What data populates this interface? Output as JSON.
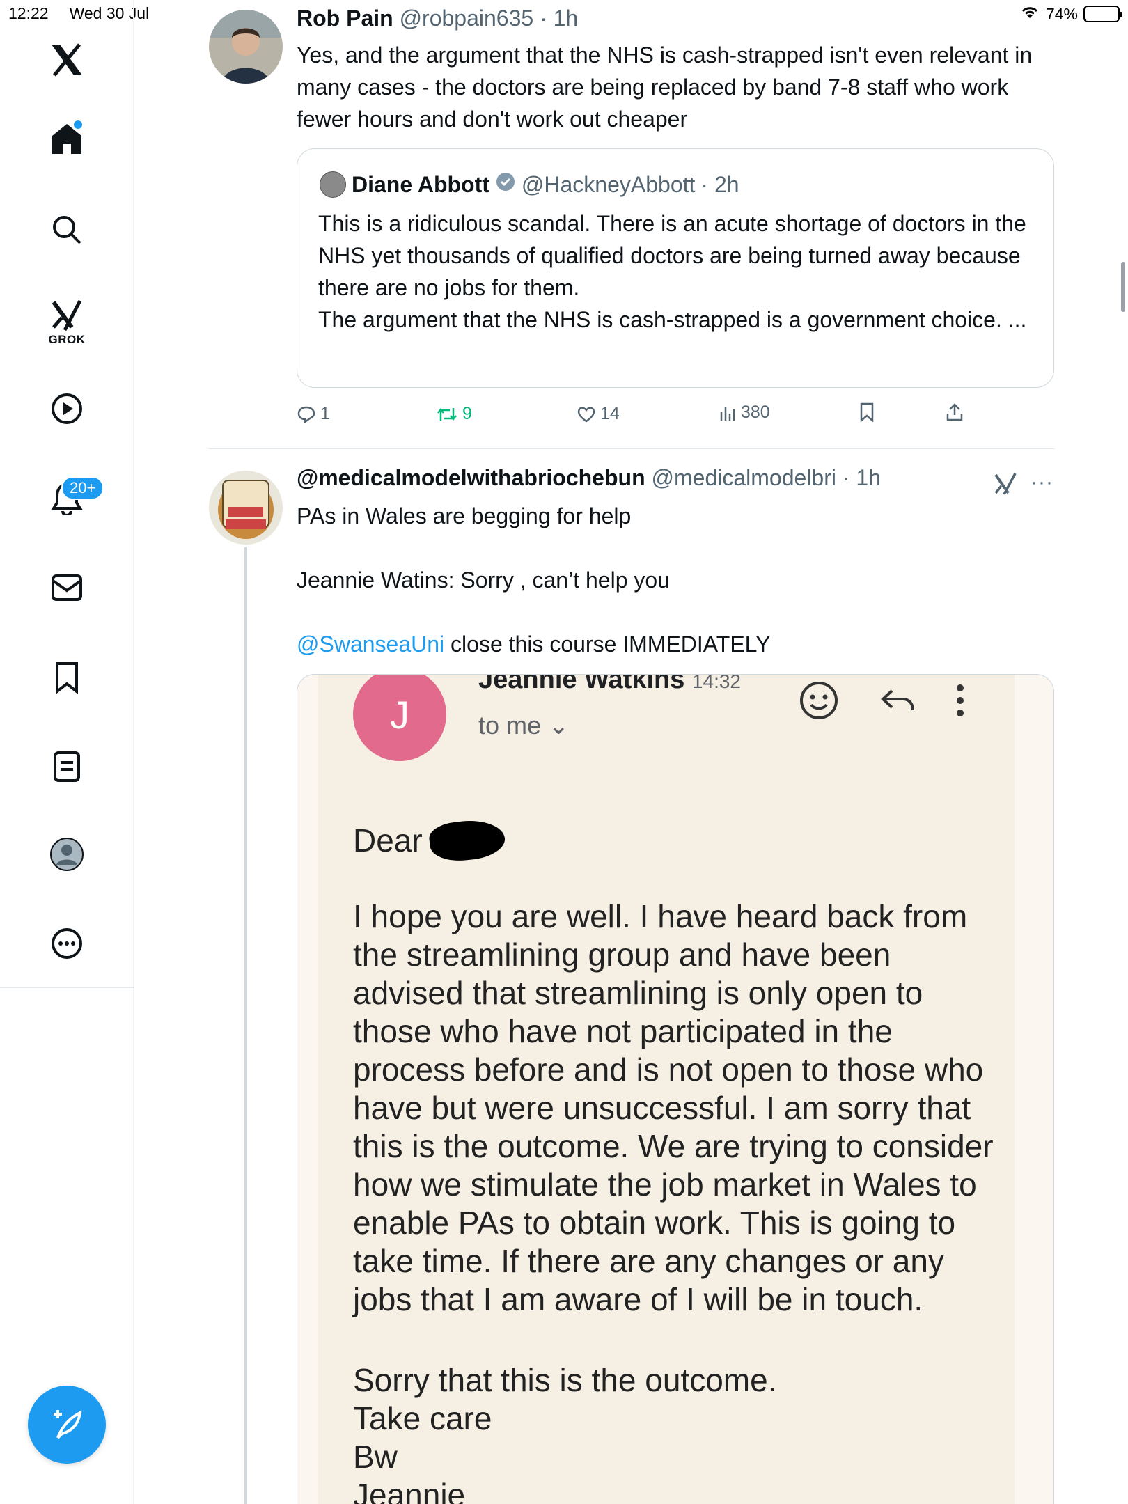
{
  "status_bar": {
    "time": "12:22",
    "date": "Wed 30 Jul",
    "battery": "74%",
    "battery_level": 0.74
  },
  "sidebar": {
    "grok_label": "GROK",
    "notifications_badge": "20+"
  },
  "tweet1": {
    "name": "Rob Pain",
    "handle": "@robpain635",
    "time": "· 1h",
    "text": "Yes, and the argument that the NHS is cash-strapped isn't even relevant in many cases - the doctors are being replaced by band 7-8 staff who work fewer hours and don't work out cheaper",
    "quote": {
      "name": "Diane Abbott",
      "handle": "@HackneyAbbott",
      "time": "· 2h",
      "text_line1": "This is a ridiculous scandal. There is an acute shortage of doctors in the NHS yet thousands of qualified doctors are being turned away because there are no jobs for them.",
      "text_line2": "The argument that the NHS is cash-strapped is a government choice. ..."
    },
    "actions": {
      "replies": "1",
      "reposts": "9",
      "likes": "14",
      "views": "380"
    }
  },
  "tweet2": {
    "name": "@medicalmodelwithabriochebun",
    "handle": "@medicalmodelbri",
    "time": "· 1h",
    "line1": "PAs in Wales are begging for help",
    "line2": "Jeannie Watins: Sorry , can’t help you",
    "mention": "@SwanseaUni",
    "line3_rest": " close this course IMMEDIATELY",
    "email": {
      "avatar_letter": "J",
      "sender": "Jeannie Watkins",
      "time": "14:32",
      "to": "to me",
      "greeting": "Dear",
      "body": "I hope you are well. I have heard back from the streamlining group and have been advised that streamlining is only open to those who have not participated in the process before and is not open to those who have but were unsuccessful. I am sorry that this is the outcome. We are trying to consider how we stimulate the job market in Wales to enable PAs to obtain work. This is going to take time. If there are any changes or any jobs that I am aware of I will be in touch.",
      "sign": "Sorry that this is the outcome.\nTake care\nBw\nJeannie"
    }
  },
  "colors": {
    "accent": "#1d9bf0",
    "repost": "#00ba7c",
    "muted": "#536471"
  }
}
